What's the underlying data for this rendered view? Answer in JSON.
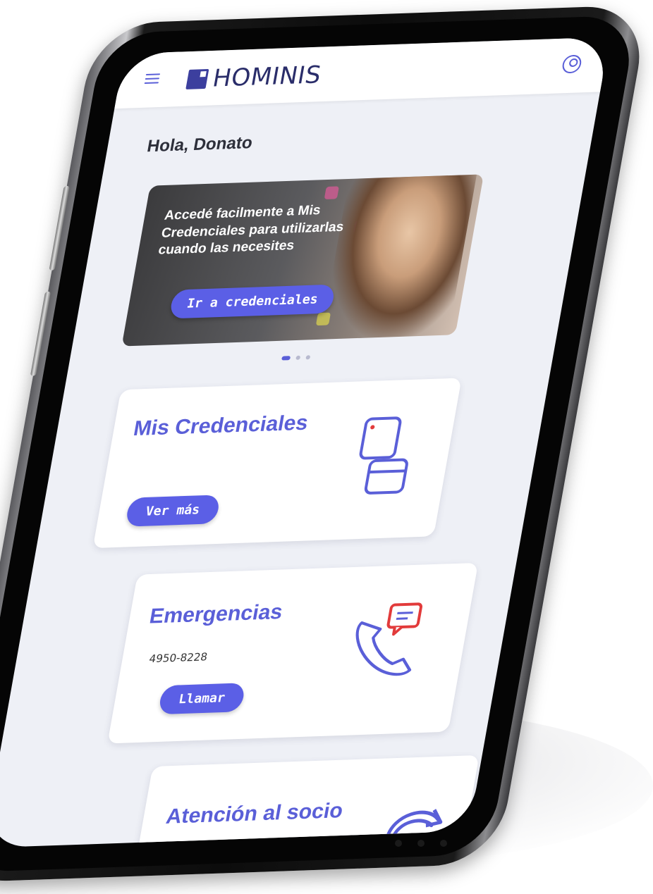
{
  "header": {
    "brand": "HOMINIS",
    "menu_icon": "hamburger-menu-icon",
    "profile_icon": "user-profile-icon"
  },
  "greeting": "Hola, Donato",
  "banner": {
    "text": "Accedé facilmente a Mis Credenciales para utilizarlas cuando las necesites",
    "button_label": "Ir a credenciales"
  },
  "carousel": {
    "total": 3,
    "active": 1
  },
  "cards": {
    "credentials": {
      "title": "Mis Credenciales",
      "button_label": "Ver más",
      "icon": "credential-cards-icon"
    },
    "emergencies": {
      "title": "Emergencias",
      "phone": "4950-8228",
      "button_label": "Llamar",
      "icon": "phone-chat-icon"
    },
    "support": {
      "title": "Atención al socio",
      "icon": "refresh-arrow-icon"
    }
  },
  "colors": {
    "accent": "#5b5fe6",
    "brand": "#2a2d6a",
    "alert": "#e23b3b",
    "screen_bg": "#eef0f6"
  }
}
